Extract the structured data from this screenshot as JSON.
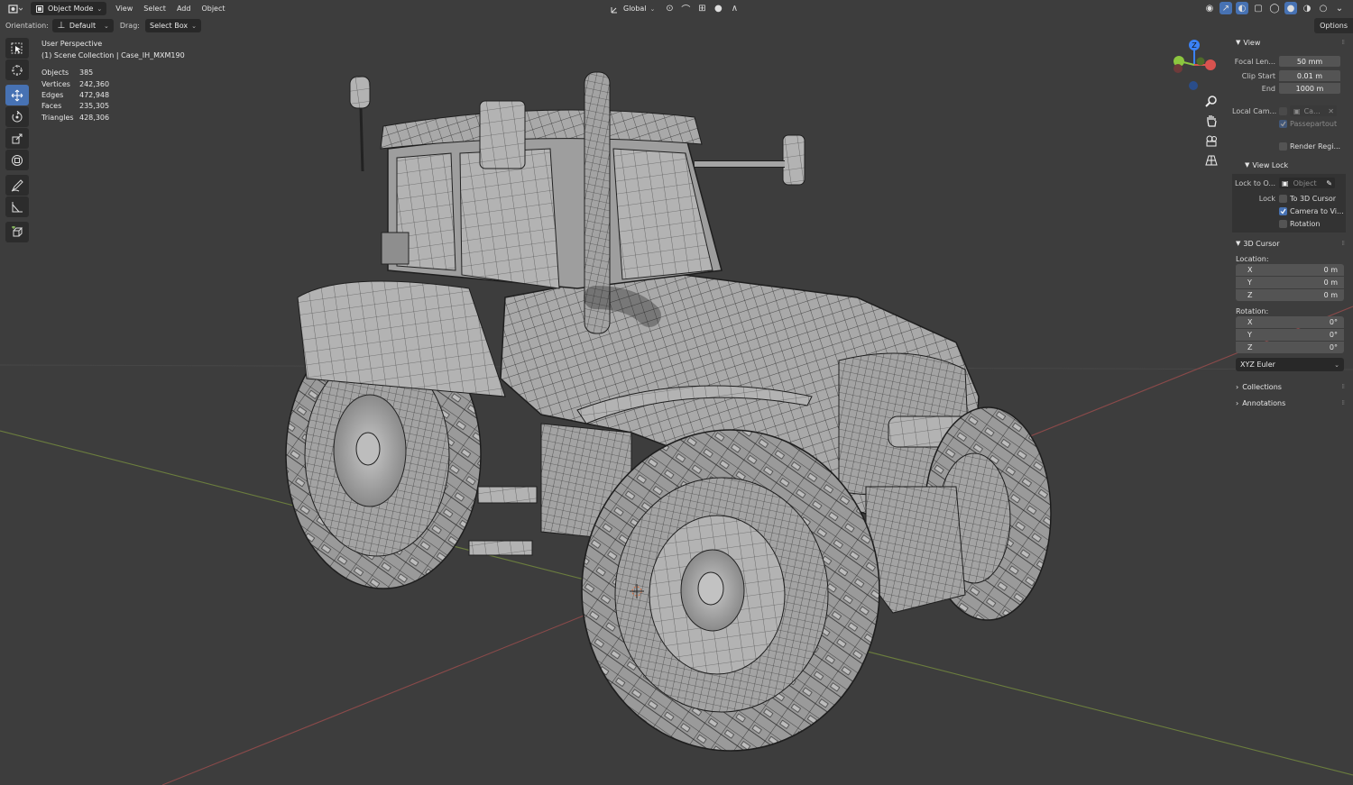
{
  "header": {
    "mode": "Object Mode",
    "menus": [
      "View",
      "Select",
      "Add",
      "Object"
    ],
    "transform_orientation": "Global"
  },
  "subheader": {
    "orientation_label": "Orientation:",
    "orientation_value": "Default",
    "drag_label": "Drag:",
    "drag_value": "Select Box",
    "options_tab": "Options"
  },
  "overlay": {
    "view_name": "User Perspective",
    "collection": "(1) Scene Collection | Case_IH_MXM190",
    "stats": [
      {
        "label": "Objects",
        "value": "385"
      },
      {
        "label": "Vertices",
        "value": "242,360"
      },
      {
        "label": "Edges",
        "value": "472,948"
      },
      {
        "label": "Faces",
        "value": "235,305"
      },
      {
        "label": "Triangles",
        "value": "428,306"
      }
    ]
  },
  "gizmo": {
    "z": "Z",
    "y": "Y",
    "x": "X"
  },
  "toolbar": {
    "tools": [
      "select-box-tool",
      "cursor-tool",
      "move-tool",
      "rotate-tool",
      "scale-tool",
      "transform-tool",
      "annotate-tool",
      "measure-tool",
      "add-cube-tool"
    ],
    "active": "move-tool"
  },
  "npanel": {
    "view": {
      "title": "View",
      "focal_label": "Focal Len...",
      "focal_value": "50 mm",
      "clip_start_label": "Clip Start",
      "clip_start_value": "0.01 m",
      "end_label": "End",
      "end_value": "1000 m",
      "local_cam_label": "Local Cam...",
      "local_cam_value": "Ca...",
      "passepartout": "Passepartout",
      "render_region": "Render Regi..."
    },
    "view_lock": {
      "title": "View Lock",
      "lock_to_label": "Lock to O...",
      "lock_to_placeholder": "Object",
      "lock_label": "Lock",
      "to_3d_cursor": "To 3D Cursor",
      "camera_to_view": "Camera to Vi...",
      "rotation": "Rotation"
    },
    "cursor": {
      "title": "3D Cursor",
      "location_label": "Location:",
      "location": [
        {
          "axis": "X",
          "value": "0 m"
        },
        {
          "axis": "Y",
          "value": "0 m"
        },
        {
          "axis": "Z",
          "value": "0 m"
        }
      ],
      "rotation_label": "Rotation:",
      "rotation": [
        {
          "axis": "X",
          "value": "0°"
        },
        {
          "axis": "Y",
          "value": "0°"
        },
        {
          "axis": "Z",
          "value": "0°"
        }
      ],
      "rotation_mode": "XYZ Euler"
    },
    "collections": "Collections",
    "annotations": "Annotations"
  },
  "colors": {
    "background": "#3d3d3d",
    "active_blue": "#4772b3",
    "field": "#545454",
    "wire": "#1a1a1a",
    "mesh": "#a7a7a7",
    "x_axis": "#d9534f",
    "y_axis": "#8cc63f",
    "z_axis": "#3b82f6"
  }
}
